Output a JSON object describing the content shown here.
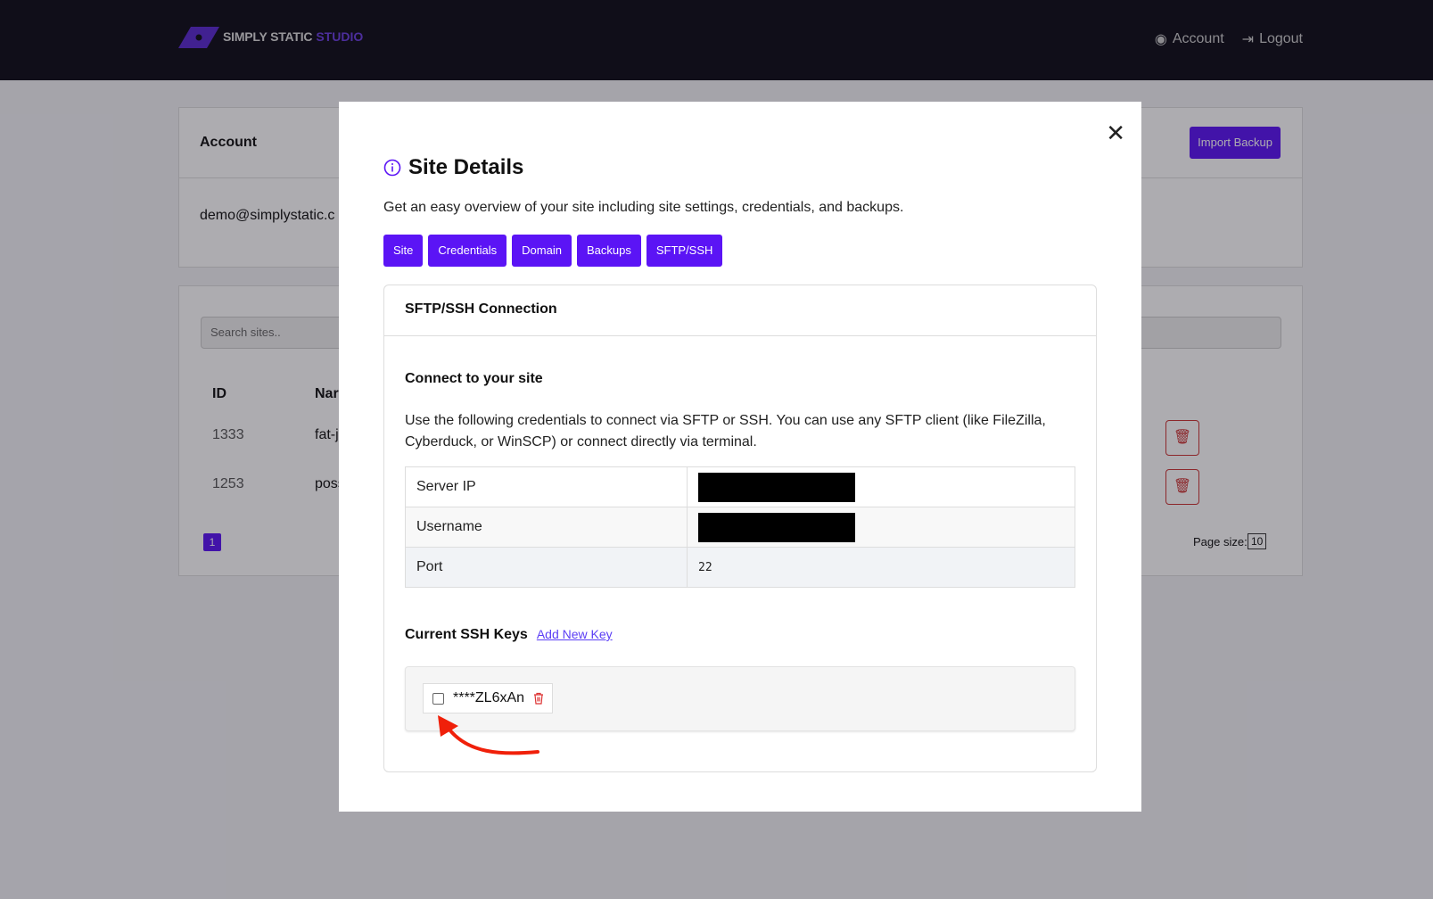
{
  "header": {
    "logo_main": "SIMPLY STATIC",
    "logo_accent": "STUDIO",
    "nav": [
      {
        "label": "Account",
        "icon": "eye-icon"
      },
      {
        "label": "Logout",
        "icon": "logout-icon"
      }
    ]
  },
  "background": {
    "account_title": "Account",
    "email": "demo@simplystatic.c",
    "import_button": "Import Backup",
    "search_placeholder": "Search sites..",
    "columns": [
      "ID",
      "Nar"
    ],
    "rows": [
      {
        "id": "1333",
        "name": "fat-j"
      },
      {
        "id": "1253",
        "name": "poss"
      }
    ],
    "page": "1",
    "page_size_label": "Page size:",
    "page_size": "10"
  },
  "modal": {
    "title": "Site Details",
    "subtitle": "Get an easy overview of your site including site settings, credentials, and backups.",
    "tabs": [
      "Site",
      "Credentials",
      "Domain",
      "Backups",
      "SFTP/SSH"
    ],
    "card_title": "SFTP/SSH Connection",
    "connect_heading": "Connect to your site",
    "connect_text": "Use the following credentials to connect via SFTP or SSH. You can use any SFTP client (like FileZilla, Cyberduck, or WinSCP) or connect directly via terminal.",
    "credentials": [
      {
        "label": "Server IP",
        "value": ""
      },
      {
        "label": "Username",
        "value": ""
      },
      {
        "label": "Port",
        "value": "22"
      }
    ],
    "keys_heading": "Current SSH Keys",
    "add_key": "Add New Key",
    "keys": [
      {
        "name": "****ZL6xAn"
      }
    ]
  },
  "colors": {
    "accent": "#5b14f5",
    "header_bg": "#0e0d18",
    "danger": "#d33",
    "arrow": "#f0200a"
  }
}
